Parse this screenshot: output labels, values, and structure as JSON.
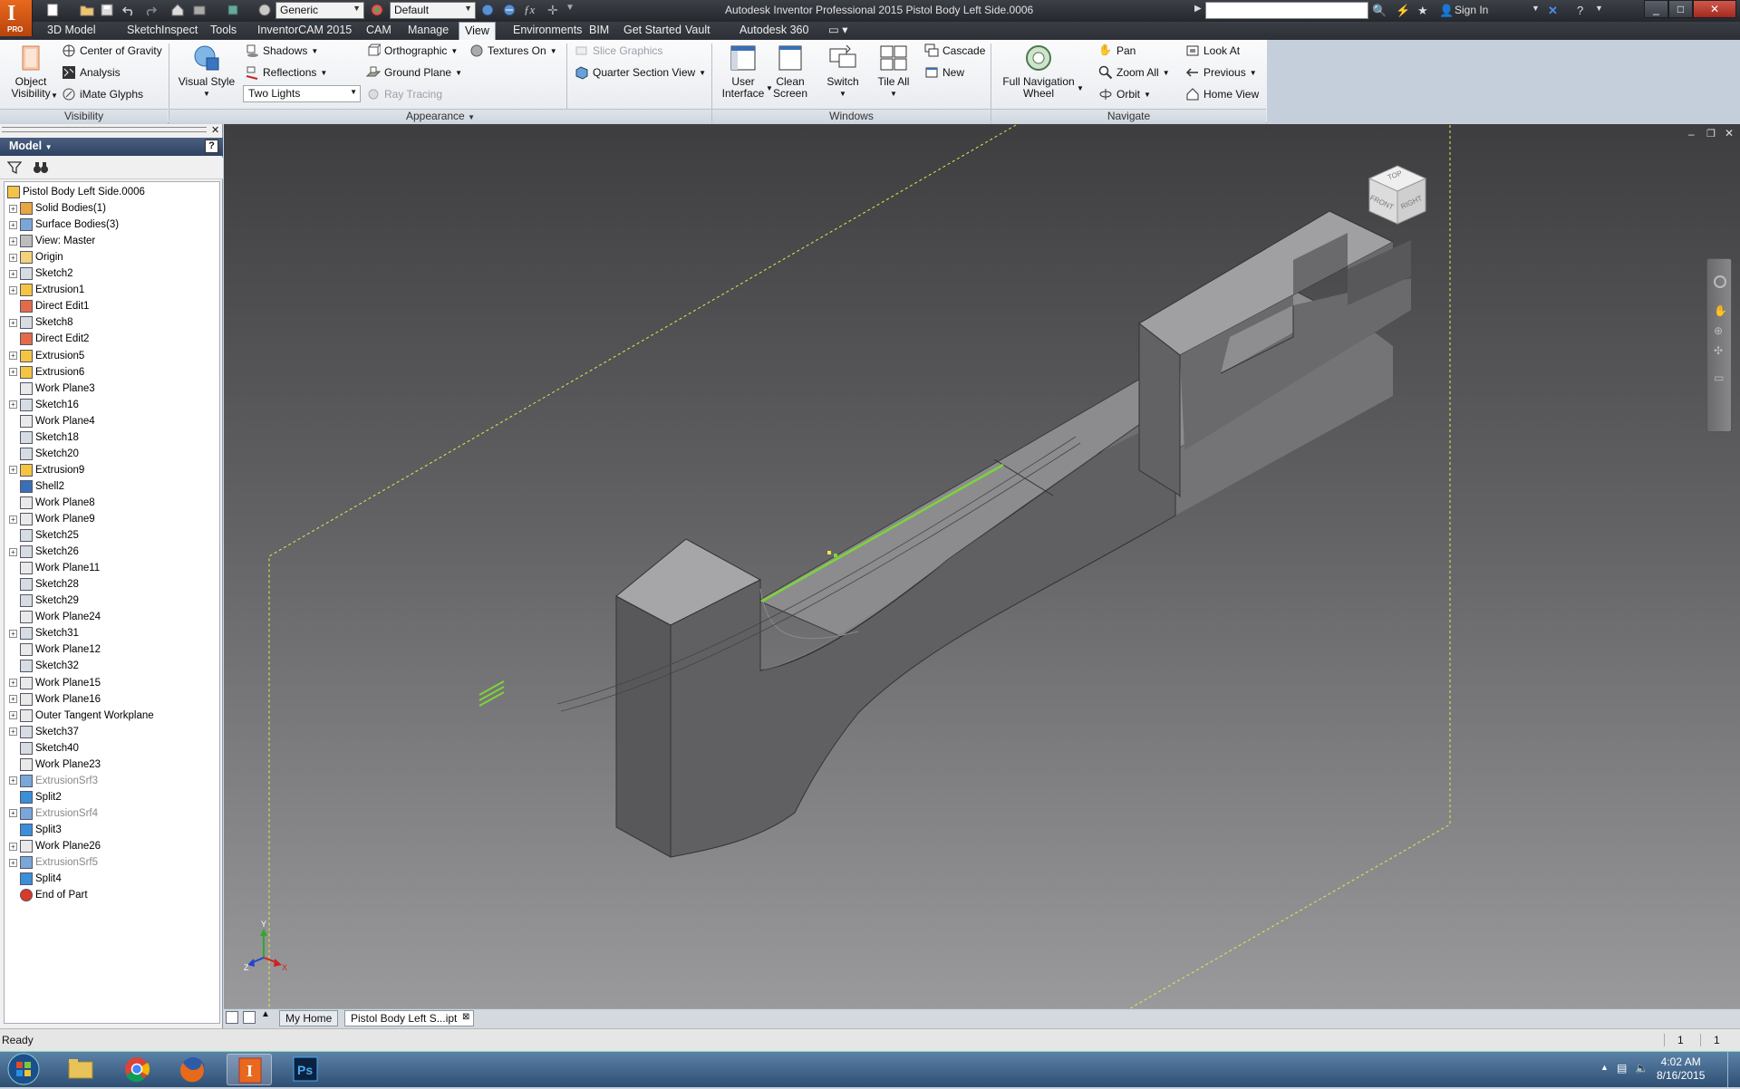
{
  "app": {
    "title": "Autodesk Inventor Professional 2015    Pistol Body Left Side.0006",
    "logo_text": "I",
    "logo_sub": "PRO"
  },
  "quick_access": {
    "material_combo": "Generic",
    "appearance_combo": "Default",
    "icons": [
      "new-icon",
      "open-icon",
      "save-icon",
      "undo-icon",
      "redo-icon",
      "home-icon",
      "return-icon",
      "select-icon",
      "color-icon",
      "measure-icon",
      "parameters-icon",
      "fx-icon",
      "customize-icon"
    ]
  },
  "titlebar_right": {
    "search_placeholder": "",
    "sign_in": "Sign In",
    "icons": [
      "binoculars-icon",
      "help-link-icon",
      "star-icon",
      "user-icon",
      "exchange-icon",
      "help-icon"
    ],
    "window_buttons": [
      "_",
      "□",
      "✕"
    ]
  },
  "menu_tabs": [
    "3D Model",
    "Sketch",
    "Inspect",
    "Tools",
    "InventorCAM 2015",
    "CAM",
    "Manage",
    "View",
    "Environments",
    "BIM",
    "Get Started",
    "Vault",
    "Autodesk 360",
    "▭ ▾"
  ],
  "active_tab": "View",
  "ribbon": {
    "visibility": {
      "label": "Visibility",
      "object_visibility": "Object\nVisibility",
      "items": [
        "Center of Gravity",
        "Analysis",
        "iMate Glyphs"
      ]
    },
    "appearance": {
      "label": "Appearance",
      "visual_style": "Visual Style",
      "col1": [
        "Shadows",
        "Reflections"
      ],
      "lighting_combo": "Two Lights",
      "col2": [
        "Orthographic",
        "Ground Plane",
        "Ray Tracing"
      ],
      "textures": "Textures On",
      "col3": [
        "Slice Graphics",
        "Quarter Section View"
      ]
    },
    "windows": {
      "label": "Windows",
      "user_interface": "User\nInterface",
      "clean_screen": "Clean\nScreen",
      "switch": "Switch",
      "tile_all": "Tile All",
      "col": [
        "Cascade",
        "New"
      ]
    },
    "navigate": {
      "label": "Navigate",
      "full_nav": "Full Navigation\nWheel",
      "col1": [
        "Pan",
        "Zoom All",
        "Orbit"
      ],
      "col2": [
        "Look At",
        "Previous",
        "Home View"
      ]
    }
  },
  "browser": {
    "header": "Model",
    "help": "?",
    "close": "✕",
    "nodes": [
      {
        "label": "Pistol Body Left Side.0006",
        "expand": false,
        "icon": "part"
      },
      {
        "label": "Solid Bodies(1)",
        "expand": true,
        "icon": "solid"
      },
      {
        "label": "Surface Bodies(3)",
        "expand": true,
        "icon": "surface"
      },
      {
        "label": "View: Master",
        "expand": true,
        "icon": "view"
      },
      {
        "label": "Origin",
        "expand": true,
        "icon": "folder"
      },
      {
        "label": "Sketch2",
        "expand": true,
        "icon": "sketch"
      },
      {
        "label": "Extrusion1",
        "expand": true,
        "icon": "extrude"
      },
      {
        "label": "Direct Edit1",
        "expand": false,
        "icon": "direct"
      },
      {
        "label": "Sketch8",
        "expand": true,
        "icon": "sketch"
      },
      {
        "label": "Direct Edit2",
        "expand": false,
        "icon": "direct"
      },
      {
        "label": "Extrusion5",
        "expand": true,
        "icon": "extrude"
      },
      {
        "label": "Extrusion6",
        "expand": true,
        "icon": "extrude"
      },
      {
        "label": "Work Plane3",
        "expand": false,
        "icon": "plane"
      },
      {
        "label": "Sketch16",
        "expand": true,
        "icon": "sketch"
      },
      {
        "label": "Work Plane4",
        "expand": false,
        "icon": "plane"
      },
      {
        "label": "Sketch18",
        "expand": false,
        "icon": "sketch"
      },
      {
        "label": "Sketch20",
        "expand": false,
        "icon": "sketch"
      },
      {
        "label": "Extrusion9",
        "expand": true,
        "icon": "extrude"
      },
      {
        "label": "Shell2",
        "expand": false,
        "icon": "shell"
      },
      {
        "label": "Work Plane8",
        "expand": false,
        "icon": "plane"
      },
      {
        "label": "Work Plane9",
        "expand": true,
        "icon": "plane"
      },
      {
        "label": "Sketch25",
        "expand": false,
        "icon": "sketch"
      },
      {
        "label": "Sketch26",
        "expand": true,
        "icon": "sketch"
      },
      {
        "label": "Work Plane11",
        "expand": false,
        "icon": "plane"
      },
      {
        "label": "Sketch28",
        "expand": false,
        "icon": "sketch"
      },
      {
        "label": "Sketch29",
        "expand": false,
        "icon": "sketch"
      },
      {
        "label": "Work Plane24",
        "expand": false,
        "icon": "plane"
      },
      {
        "label": "Sketch31",
        "expand": true,
        "icon": "sketch"
      },
      {
        "label": "Work Plane12",
        "expand": false,
        "icon": "plane"
      },
      {
        "label": "Sketch32",
        "expand": false,
        "icon": "sketch"
      },
      {
        "label": "Work Plane15",
        "expand": true,
        "icon": "plane"
      },
      {
        "label": "Work Plane16",
        "expand": true,
        "icon": "plane"
      },
      {
        "label": "Outer Tangent Workplane",
        "expand": true,
        "icon": "plane"
      },
      {
        "label": "Sketch37",
        "expand": true,
        "icon": "sketch"
      },
      {
        "label": "Sketch40",
        "expand": false,
        "icon": "sketch"
      },
      {
        "label": "Work Plane23",
        "expand": false,
        "icon": "plane"
      },
      {
        "label": "ExtrusionSrf3",
        "expand": true,
        "icon": "surface",
        "grey": true
      },
      {
        "label": "Split2",
        "expand": false,
        "icon": "split"
      },
      {
        "label": "ExtrusionSrf4",
        "expand": true,
        "icon": "surface",
        "grey": true
      },
      {
        "label": "Split3",
        "expand": false,
        "icon": "split"
      },
      {
        "label": "Work Plane26",
        "expand": true,
        "icon": "plane"
      },
      {
        "label": "ExtrusionSrf5",
        "expand": true,
        "icon": "surface",
        "grey": true
      },
      {
        "label": "Split4",
        "expand": false,
        "icon": "split"
      },
      {
        "label": "End of Part",
        "expand": false,
        "icon": "end"
      }
    ]
  },
  "viewcube": {
    "front": "FRONT",
    "right": "RIGHT",
    "top": "TOP"
  },
  "triad": {
    "x": "X",
    "y": "Y",
    "z": "Z"
  },
  "doc_tabs": [
    "My Home",
    "Pistol Body Left S...ipt"
  ],
  "status": {
    "text": "Ready",
    "count1": "1",
    "count2": "1"
  },
  "taskbar": {
    "apps": [
      "start-orb-icon",
      "explorer-icon",
      "chrome-icon",
      "firefox-icon",
      "inventor-icon",
      "photoshop-icon"
    ],
    "time": "4:02 AM",
    "date": "8/16/2015"
  },
  "colors": {
    "accent": "#e8691e",
    "selection_green": "#7dd43a",
    "workplane_yellow": "#e8e84a"
  }
}
